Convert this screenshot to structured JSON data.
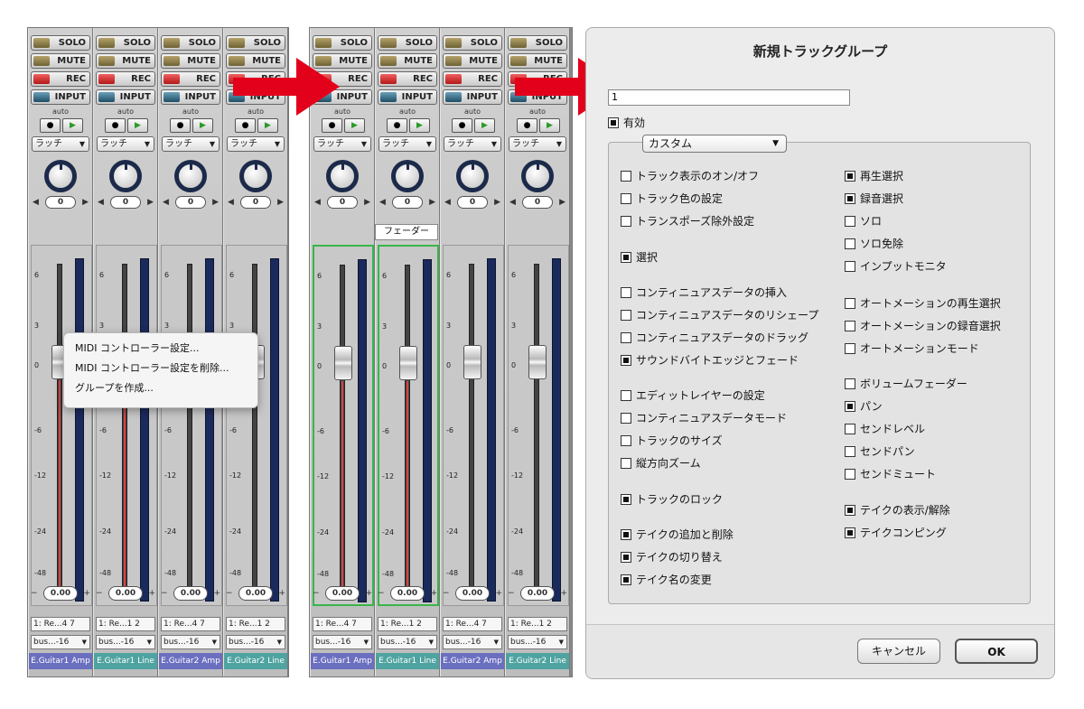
{
  "mixer": {
    "solo_label": "SOLO",
    "mute_label": "MUTE",
    "rec_label": "REC",
    "input_label": "INPUT",
    "auto_label": "auto",
    "latch_label": "ラッチ",
    "pan_value": "0",
    "volume_value": "0.00",
    "scale": [
      "6",
      "3",
      "0",
      "-6",
      "-12",
      "-24",
      "-48"
    ],
    "strips": [
      {
        "io1": "1: Re...4 7",
        "io2": "bus...-16",
        "name": "E.Guitar1 Amp",
        "color": "blue"
      },
      {
        "io1": "1: Re...1 2",
        "io2": "bus...-16",
        "name": "E.Guitar1 Line",
        "color": "teal"
      },
      {
        "io1": "1: Re...4 7",
        "io2": "bus...-16",
        "name": "E.Guitar2 Amp",
        "color": "blue"
      },
      {
        "io1": "1: Re...1 2",
        "io2": "bus...-16",
        "name": "E.Guitar2 Line",
        "color": "teal"
      }
    ]
  },
  "context_menu": {
    "items": [
      "MIDI コントローラー設定...",
      "MIDI コントローラー設定を削除...",
      "グループを作成..."
    ]
  },
  "tooltip": "フェーダー",
  "dialog": {
    "title": "新規トラックグループ",
    "name_value": "1",
    "enabled_label": "有効",
    "preset": "カスタム",
    "left": [
      {
        "label": "トラック表示のオン/オフ",
        "on": false
      },
      {
        "label": "トラック色の設定",
        "on": false
      },
      {
        "label": "トランスポーズ除外設定",
        "on": false
      },
      {
        "label": "選択",
        "on": true
      },
      {
        "label": "コンティニュアスデータの挿入",
        "on": false
      },
      {
        "label": "コンティニュアスデータのリシェープ",
        "on": false
      },
      {
        "label": "コンティニュアスデータのドラッグ",
        "on": false
      },
      {
        "label": "サウンドバイトエッジとフェード",
        "on": true
      },
      {
        "label": "エディットレイヤーの設定",
        "on": false
      },
      {
        "label": "コンティニュアスデータモード",
        "on": false
      },
      {
        "label": "トラックのサイズ",
        "on": false
      },
      {
        "label": "縦方向ズーム",
        "on": false
      },
      {
        "label": "トラックのロック",
        "on": true
      },
      {
        "label": "テイクの追加と削除",
        "on": true
      },
      {
        "label": "テイクの切り替え",
        "on": true
      },
      {
        "label": "テイク名の変更",
        "on": true
      }
    ],
    "right": [
      {
        "label": "再生選択",
        "on": true
      },
      {
        "label": "録音選択",
        "on": true
      },
      {
        "label": "ソロ",
        "on": false
      },
      {
        "label": "ソロ免除",
        "on": false
      },
      {
        "label": "インプットモニタ",
        "on": false
      },
      {
        "label": "オートメーションの再生選択",
        "on": false
      },
      {
        "label": "オートメーションの録音選択",
        "on": false
      },
      {
        "label": "オートメーションモード",
        "on": false
      },
      {
        "label": "ボリュームフェーダー",
        "on": false
      },
      {
        "label": "パン",
        "on": true
      },
      {
        "label": "センドレベル",
        "on": false
      },
      {
        "label": "センドパン",
        "on": false
      },
      {
        "label": "センドミュート",
        "on": false
      },
      {
        "label": "テイクの表示/解除",
        "on": true
      },
      {
        "label": "テイクコンピング",
        "on": true
      }
    ],
    "cancel_label": "キャンセル",
    "ok_label": "OK"
  },
  "colors": {
    "arrow": "#e3001b",
    "selection": "#39b54a"
  }
}
